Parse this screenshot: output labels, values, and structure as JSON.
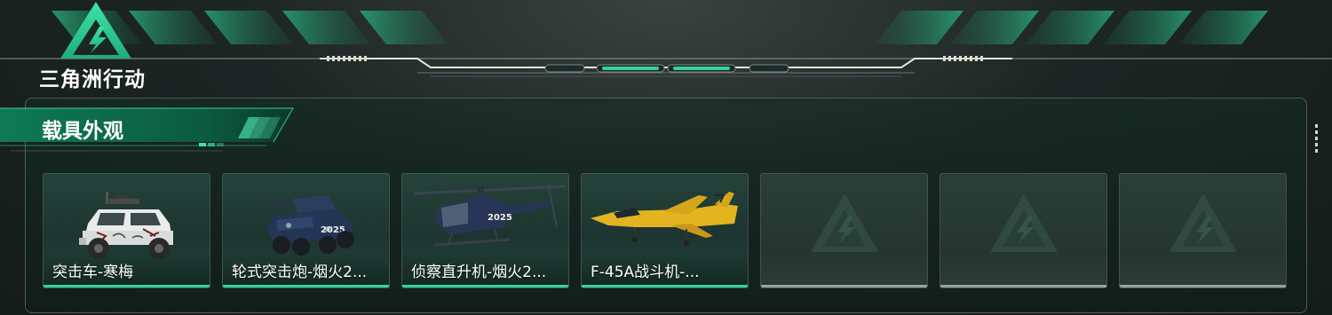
{
  "game": {
    "logo_text": "三角洲行动"
  },
  "section": {
    "title": "载具外观"
  },
  "colors": {
    "accent": "#35d39a",
    "panel_border": "#8fa59c",
    "empty_bar": "#9aa3a0"
  },
  "vehicles": [
    {
      "name": "突击车-寒梅",
      "icon": "assault-vehicle-icon",
      "state": "owned"
    },
    {
      "name": "轮式突击炮-烟火2...",
      "icon": "wheeled-assault-gun-icon",
      "state": "owned"
    },
    {
      "name": "侦察直升机-烟火2...",
      "icon": "scout-helicopter-icon",
      "state": "owned"
    },
    {
      "name": "F-45A战斗机-...",
      "icon": "fighter-jet-icon",
      "state": "owned"
    },
    {
      "name": "",
      "icon": "placeholder-logo-icon",
      "state": "empty"
    },
    {
      "name": "",
      "icon": "placeholder-logo-icon",
      "state": "empty"
    },
    {
      "name": "",
      "icon": "placeholder-logo-icon",
      "state": "empty"
    }
  ]
}
